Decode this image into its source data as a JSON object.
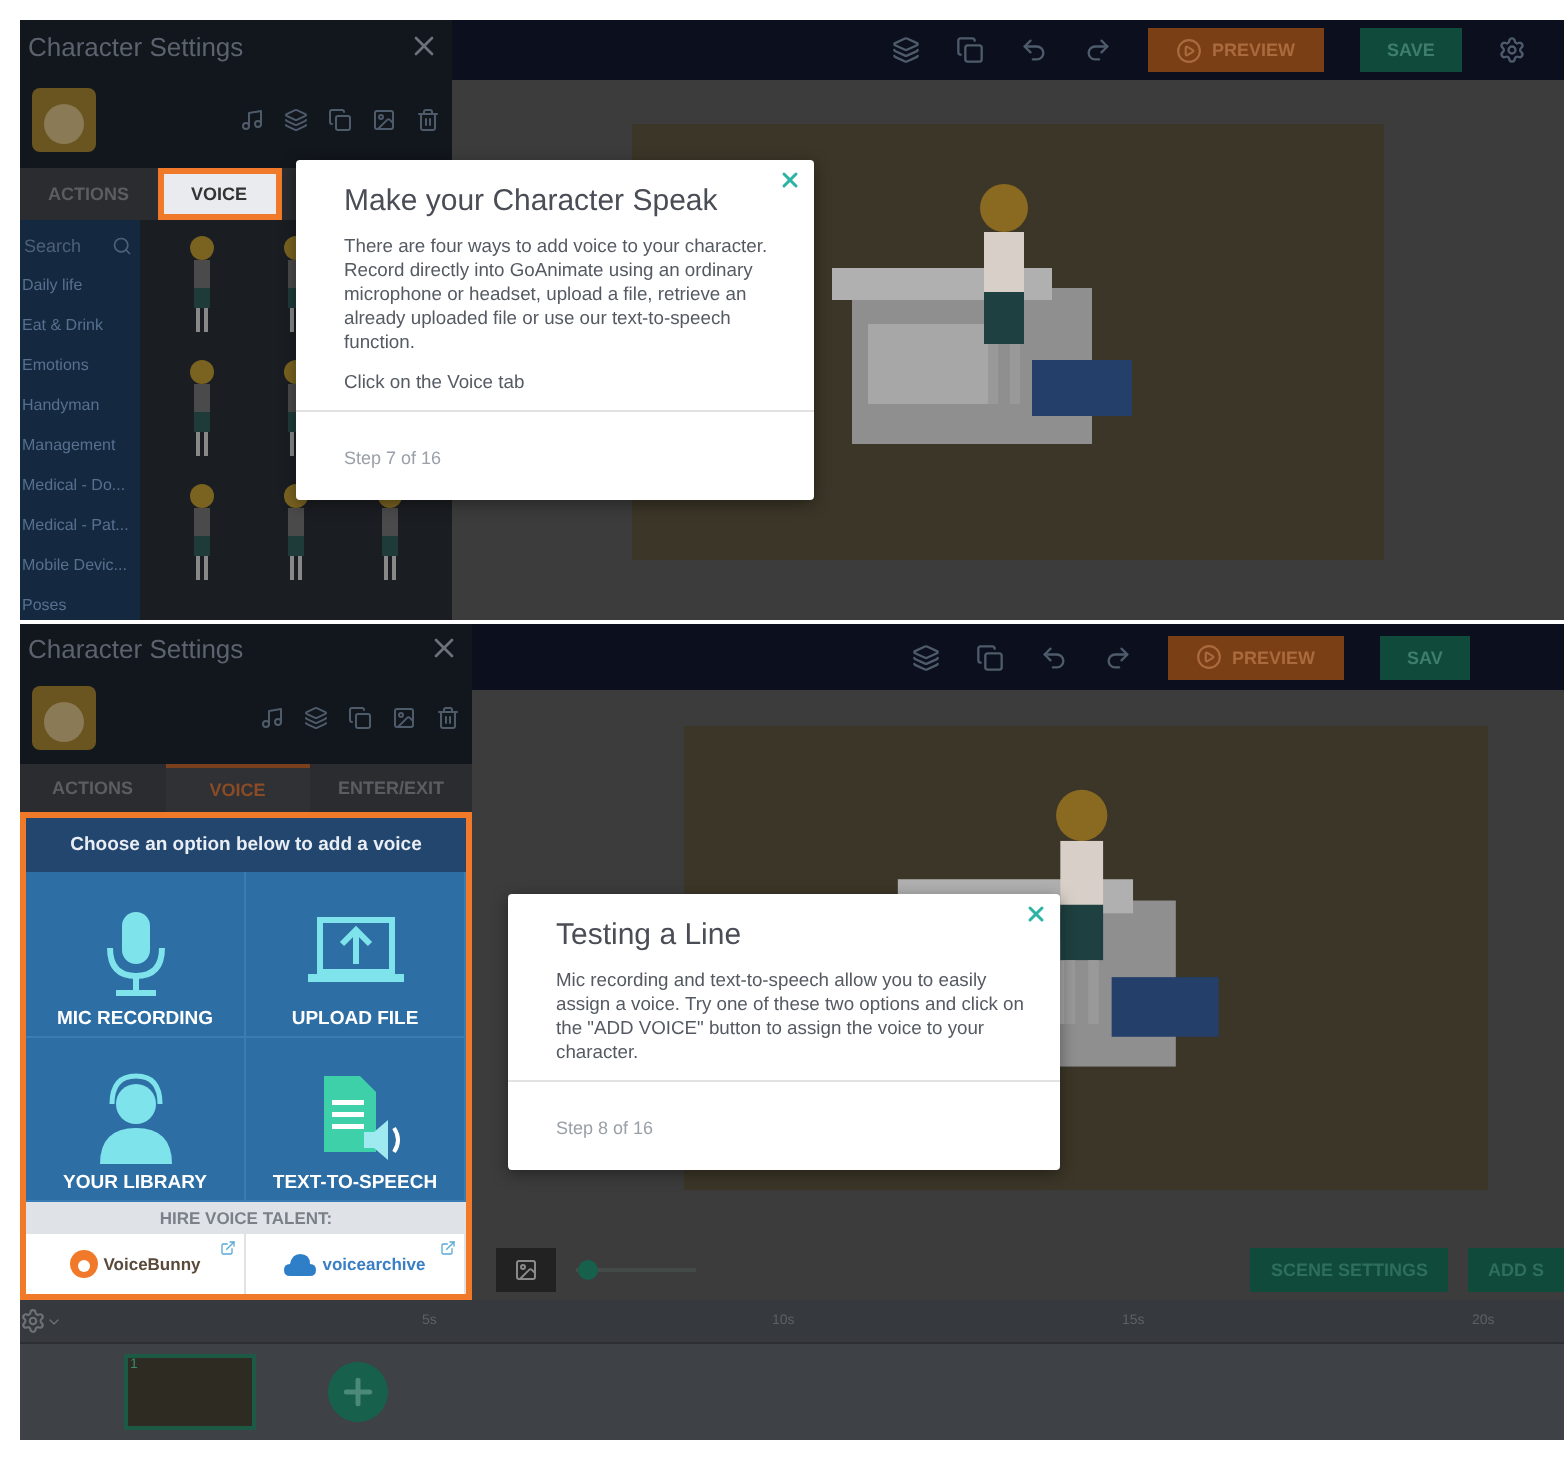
{
  "screens": [
    {
      "sidebar": {
        "title": "Character Settings",
        "tabs": [
          {
            "label": "ACTIONS",
            "selected": false,
            "highlighted": false
          },
          {
            "label": "VOICE",
            "selected": true,
            "highlighted": true
          }
        ],
        "search": {
          "placeholder": "Search"
        },
        "categories": [
          "Daily life",
          "Eat & Drink",
          "Emotions",
          "Handyman",
          "Management",
          "Medical - Do...",
          "Medical - Pat...",
          "Mobile Devic...",
          "Poses"
        ]
      },
      "toolbar": {
        "buttons": [
          {
            "label": "PREVIEW",
            "kind": "preview"
          },
          {
            "label": "SAVE",
            "kind": "save"
          }
        ]
      },
      "tour": {
        "title": "Make your Character Speak",
        "body": [
          "There are four ways to add voice to your character. Record directly into GoAnimate using an ordinary microphone or headset, upload a file, retrieve an already uploaded file or use our text-to-speech function.",
          "Click on the Voice tab"
        ],
        "step": "Step 7 of 16"
      }
    },
    {
      "sidebar": {
        "title": "Character Settings",
        "tabs": [
          {
            "label": "ACTIONS",
            "selected": false,
            "highlighted": false
          },
          {
            "label": "VOICE",
            "selected": true,
            "highlighted": false
          },
          {
            "label": "ENTER/EXIT",
            "selected": false,
            "highlighted": false
          }
        ],
        "voice_panel": {
          "highlighted": true,
          "heading": "Choose an option below to add a voice",
          "options": [
            {
              "label": "MIC RECORDING",
              "kind": "mic"
            },
            {
              "label": "UPLOAD FILE",
              "kind": "upload"
            },
            {
              "label": "YOUR LIBRARY",
              "kind": "library"
            },
            {
              "label": "TEXT-TO-SPEECH",
              "kind": "tts"
            }
          ],
          "talent_heading": "HIRE VOICE TALENT:",
          "talent": [
            {
              "name": "VoiceBunny",
              "kind": "bunny"
            },
            {
              "name": "voicearchive",
              "kind": "archive"
            }
          ]
        }
      },
      "toolbar": {
        "buttons": [
          {
            "label": "PREVIEW",
            "kind": "preview"
          },
          {
            "label": "SAV",
            "kind": "save"
          }
        ]
      },
      "tour": {
        "title": "Testing a Line",
        "body": [
          "Mic recording and text-to-speech allow you to easily assign a voice. Try one of these two options and click on the \"ADD VOICE\" button to assign the voice to your character."
        ],
        "step": "Step 8 of 16"
      },
      "stage_bar": {
        "zoom_slider": {
          "level": 0.1
        },
        "buttons": [
          "SCENE SETTINGS",
          "ADD S"
        ]
      },
      "timeline": {
        "ticks": [
          "5s",
          "10s",
          "15s",
          "20s"
        ],
        "scenes": [
          {
            "number": "1",
            "selected": true
          }
        ]
      }
    }
  ]
}
